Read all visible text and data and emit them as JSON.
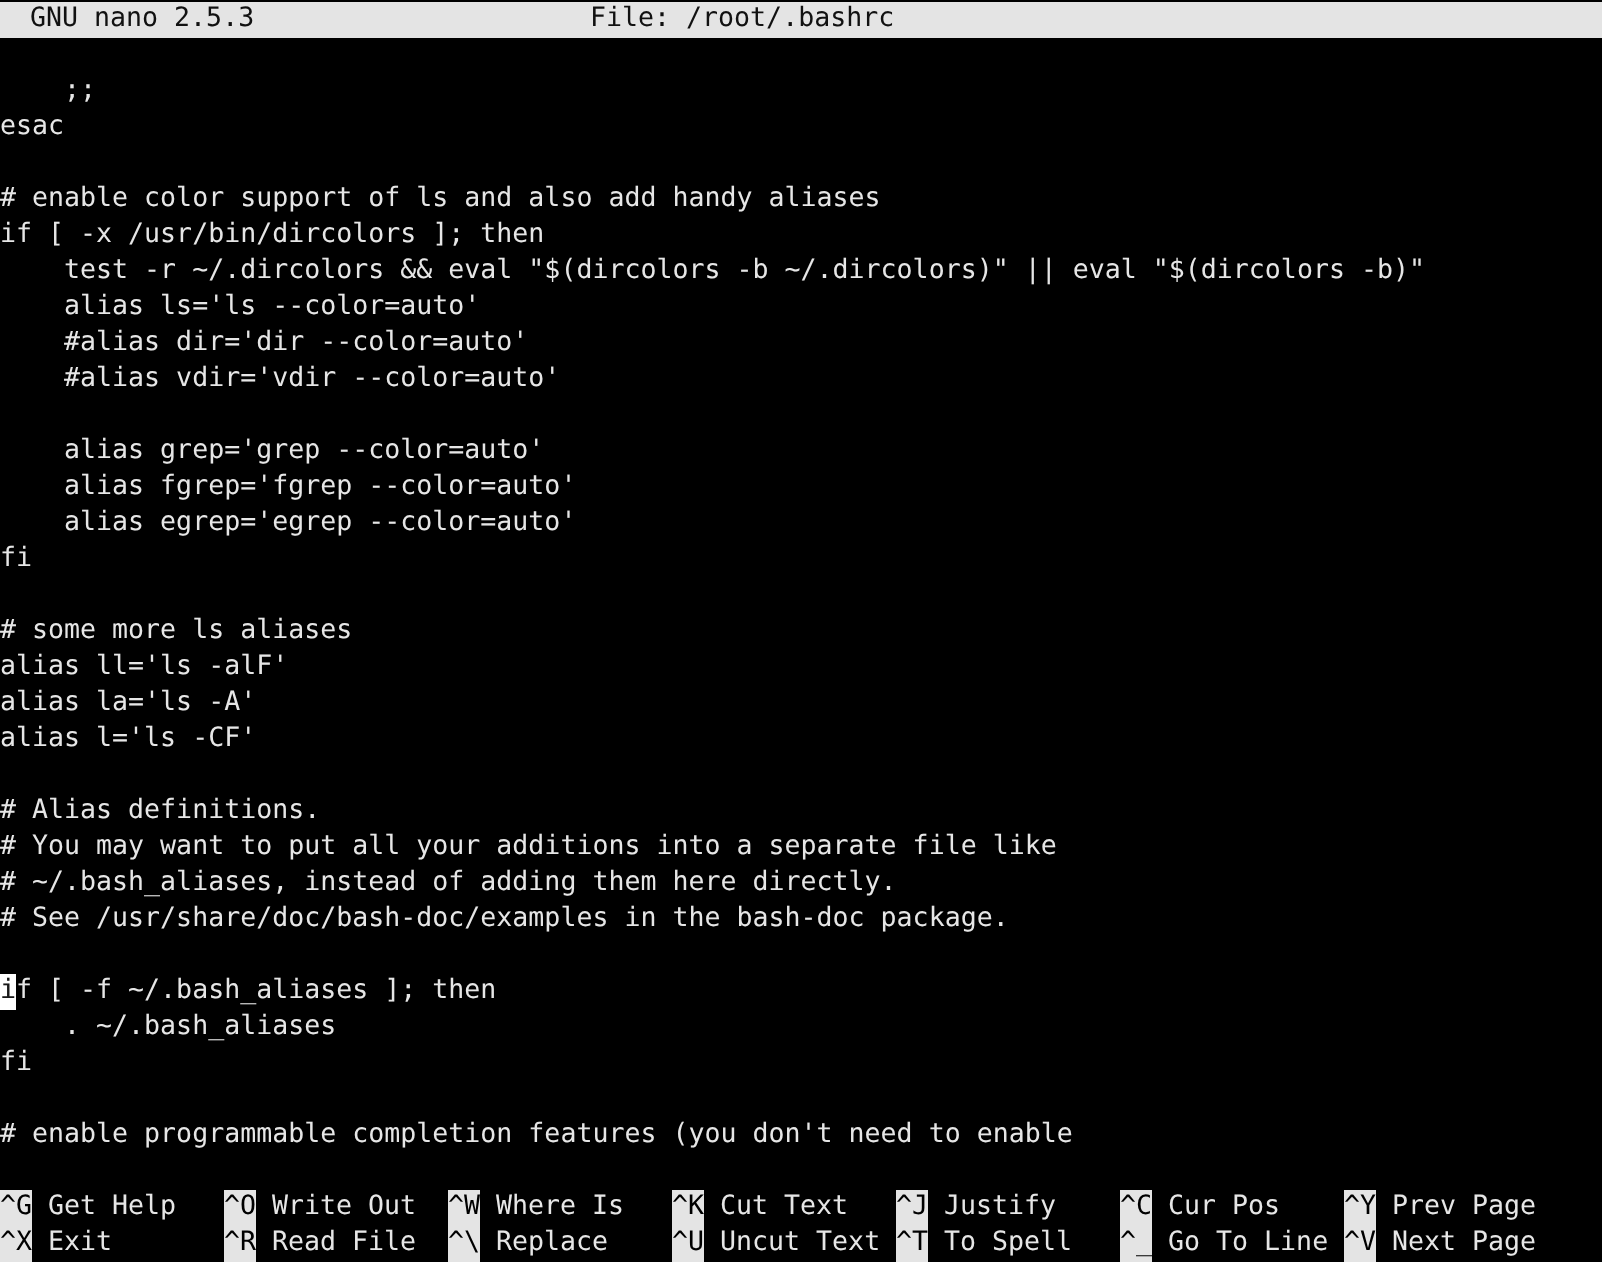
{
  "title_bar": {
    "version": "GNU nano 2.5.3",
    "file": "File: /root/.bashrc"
  },
  "lines": [
    {
      "kind": "blank"
    },
    {
      "kind": "code",
      "text": "    ;;",
      "cursor": false
    },
    {
      "kind": "code",
      "text": "esac",
      "cursor": false
    },
    {
      "kind": "blank"
    },
    {
      "kind": "code",
      "text": "# enable color support of ls and also add handy aliases",
      "cursor": false
    },
    {
      "kind": "code",
      "text": "if [ -x /usr/bin/dircolors ]; then",
      "cursor": false
    },
    {
      "kind": "code",
      "text": "    test -r ~/.dircolors && eval \"$(dircolors -b ~/.dircolors)\" || eval \"$(dircolors -b)\"",
      "cursor": false
    },
    {
      "kind": "code",
      "text": "    alias ls='ls --color=auto'",
      "cursor": false
    },
    {
      "kind": "code",
      "text": "    #alias dir='dir --color=auto'",
      "cursor": false
    },
    {
      "kind": "code",
      "text": "    #alias vdir='vdir --color=auto'",
      "cursor": false
    },
    {
      "kind": "blank"
    },
    {
      "kind": "code",
      "text": "    alias grep='grep --color=auto'",
      "cursor": false
    },
    {
      "kind": "code",
      "text": "    alias fgrep='fgrep --color=auto'",
      "cursor": false
    },
    {
      "kind": "code",
      "text": "    alias egrep='egrep --color=auto'",
      "cursor": false
    },
    {
      "kind": "code",
      "text": "fi",
      "cursor": false
    },
    {
      "kind": "blank"
    },
    {
      "kind": "code",
      "text": "# some more ls aliases",
      "cursor": false
    },
    {
      "kind": "code",
      "text": "alias ll='ls -alF'",
      "cursor": false
    },
    {
      "kind": "code",
      "text": "alias la='ls -A'",
      "cursor": false
    },
    {
      "kind": "code",
      "text": "alias l='ls -CF'",
      "cursor": false
    },
    {
      "kind": "blank"
    },
    {
      "kind": "code",
      "text": "# Alias definitions.",
      "cursor": false
    },
    {
      "kind": "code",
      "text": "# You may want to put all your additions into a separate file like",
      "cursor": false
    },
    {
      "kind": "code",
      "text": "# ~/.bash_aliases, instead of adding them here directly.",
      "cursor": false
    },
    {
      "kind": "code",
      "text": "# See /usr/share/doc/bash-doc/examples in the bash-doc package.",
      "cursor": false
    },
    {
      "kind": "blank"
    },
    {
      "kind": "code",
      "text": "if [ -f ~/.bash_aliases ]; then",
      "cursor": true
    },
    {
      "kind": "code",
      "text": "    . ~/.bash_aliases",
      "cursor": false
    },
    {
      "kind": "code",
      "text": "fi",
      "cursor": false
    },
    {
      "kind": "blank"
    },
    {
      "kind": "code",
      "text": "# enable programmable completion features (you don't need to enable",
      "cursor": false
    },
    {
      "kind": "blank"
    }
  ],
  "shortcuts": [
    [
      {
        "key": "^G",
        "label": "Get Help"
      },
      {
        "key": "^O",
        "label": "Write Out"
      },
      {
        "key": "^W",
        "label": "Where Is"
      },
      {
        "key": "^K",
        "label": "Cut Text"
      },
      {
        "key": "^J",
        "label": "Justify"
      },
      {
        "key": "^C",
        "label": "Cur Pos"
      },
      {
        "key": "^Y",
        "label": "Prev Page"
      }
    ],
    [
      {
        "key": "^X",
        "label": "Exit"
      },
      {
        "key": "^R",
        "label": "Read File"
      },
      {
        "key": "^\\",
        "label": "Replace"
      },
      {
        "key": "^U",
        "label": "Uncut Text"
      },
      {
        "key": "^T",
        "label": "To Spell"
      },
      {
        "key": "^_",
        "label": "Go To Line"
      },
      {
        "key": "^V",
        "label": "Next Page"
      }
    ]
  ]
}
